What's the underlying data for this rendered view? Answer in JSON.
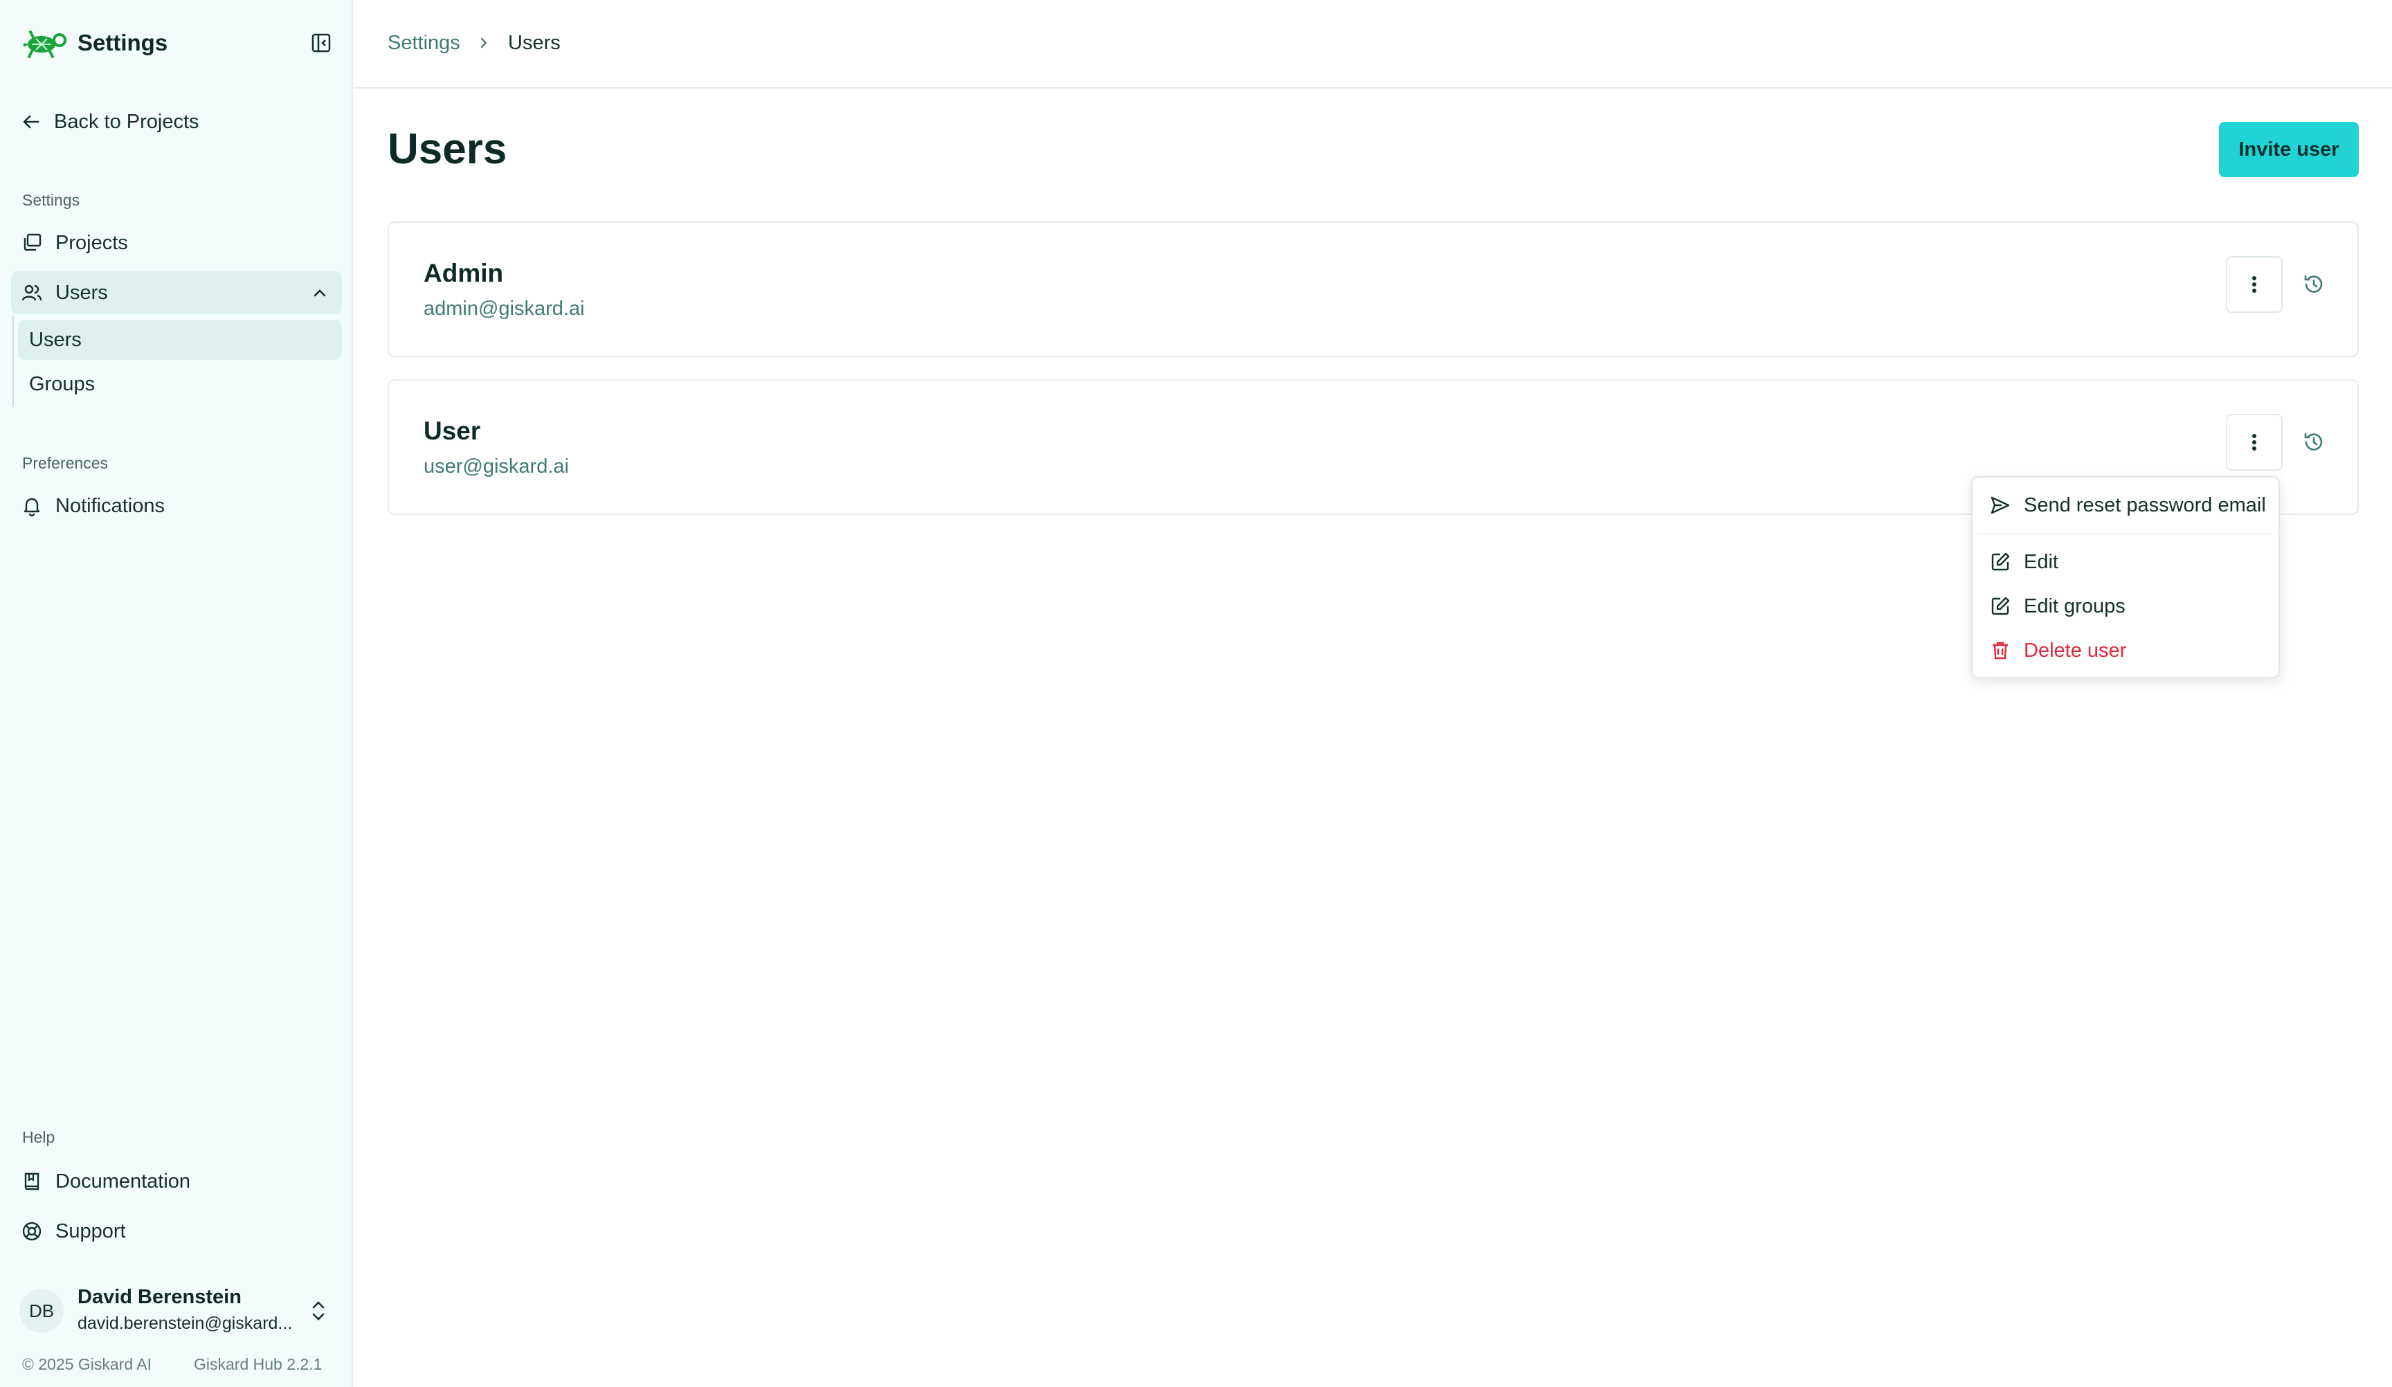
{
  "app": {
    "title": "Settings"
  },
  "sidebar": {
    "back_label": "Back to Projects",
    "sections": {
      "settings": "Settings",
      "preferences": "Preferences",
      "help": "Help"
    },
    "items": {
      "projects": "Projects",
      "users": "Users",
      "users_sub": [
        "Users",
        "Groups"
      ],
      "notifications": "Notifications",
      "documentation": "Documentation",
      "support": "Support"
    },
    "user": {
      "initials": "DB",
      "name": "David Berenstein",
      "email": "david.berenstein@giskard..."
    },
    "footer": {
      "copyright": "© 2025 Giskard AI",
      "version": "Giskard Hub 2.2.1"
    }
  },
  "breadcrumb": [
    "Settings",
    "Users"
  ],
  "main": {
    "title": "Users",
    "invite_label": "Invite user",
    "users": [
      {
        "name": "Admin",
        "email": "admin@giskard.ai"
      },
      {
        "name": "User",
        "email": "user@giskard.ai"
      }
    ]
  },
  "menu": {
    "items": [
      "Send reset password email",
      "Edit",
      "Edit groups",
      "Delete user"
    ]
  },
  "colors": {
    "accent": "#22d3d3",
    "sidebar_bg": "#f3fbfb",
    "active_bg": "#dff0f0",
    "danger": "#e0283a",
    "link": "#3e7b76",
    "logo": "#1aa33a"
  }
}
